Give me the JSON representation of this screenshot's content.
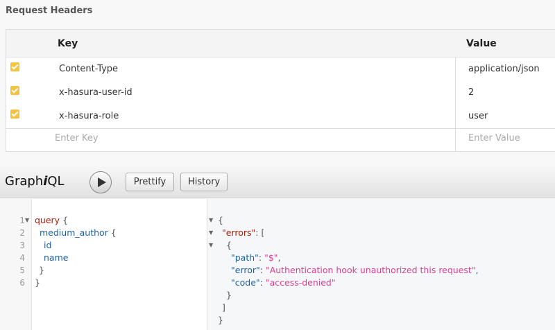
{
  "request_headers": {
    "title": "Request Headers",
    "columns": {
      "key": "Key",
      "value": "Value"
    },
    "rows": [
      {
        "key": "Content-Type",
        "value": "application/json",
        "enabled": true
      },
      {
        "key": "x-hasura-user-id",
        "value": "2",
        "enabled": true
      },
      {
        "key": "x-hasura-role",
        "value": "user",
        "enabled": true
      }
    ],
    "new_row": {
      "key_placeholder": "Enter Key",
      "value_placeholder": "Enter Value"
    }
  },
  "toolbar": {
    "logo_prefix": "Graph",
    "logo_italic": "i",
    "logo_suffix": "QL",
    "prettify_label": "Prettify",
    "history_label": "History"
  },
  "query_editor": {
    "line_numbers": [
      "1",
      "2",
      "3",
      "4",
      "5",
      "6"
    ],
    "lines": {
      "l1_kw": "query",
      "l1_brace": " {",
      "l2_field": "medium_author",
      "l2_brace": " {",
      "l3_field": "id",
      "l4_field": "name",
      "l5_brace": "}",
      "l6_brace": "}"
    }
  },
  "result": {
    "open_brace": "{",
    "errors_key": "\"errors\"",
    "errors_sep": ": [",
    "item_open": "{",
    "path_key": "\"path\"",
    "path_value": "\"$\"",
    "error_key": "\"error\"",
    "error_value": "\"Authentication hook unauthorized this request\"",
    "code_key": "\"code\"",
    "code_value": "\"access-denied\"",
    "item_close": "}",
    "array_close": "]",
    "close_brace": "}",
    "colon": ": ",
    "comma": ","
  },
  "colors": {
    "checkbox": "#f5c342",
    "keyword": "#b11a04",
    "field": "#1f61a0",
    "string": "#d64292"
  }
}
